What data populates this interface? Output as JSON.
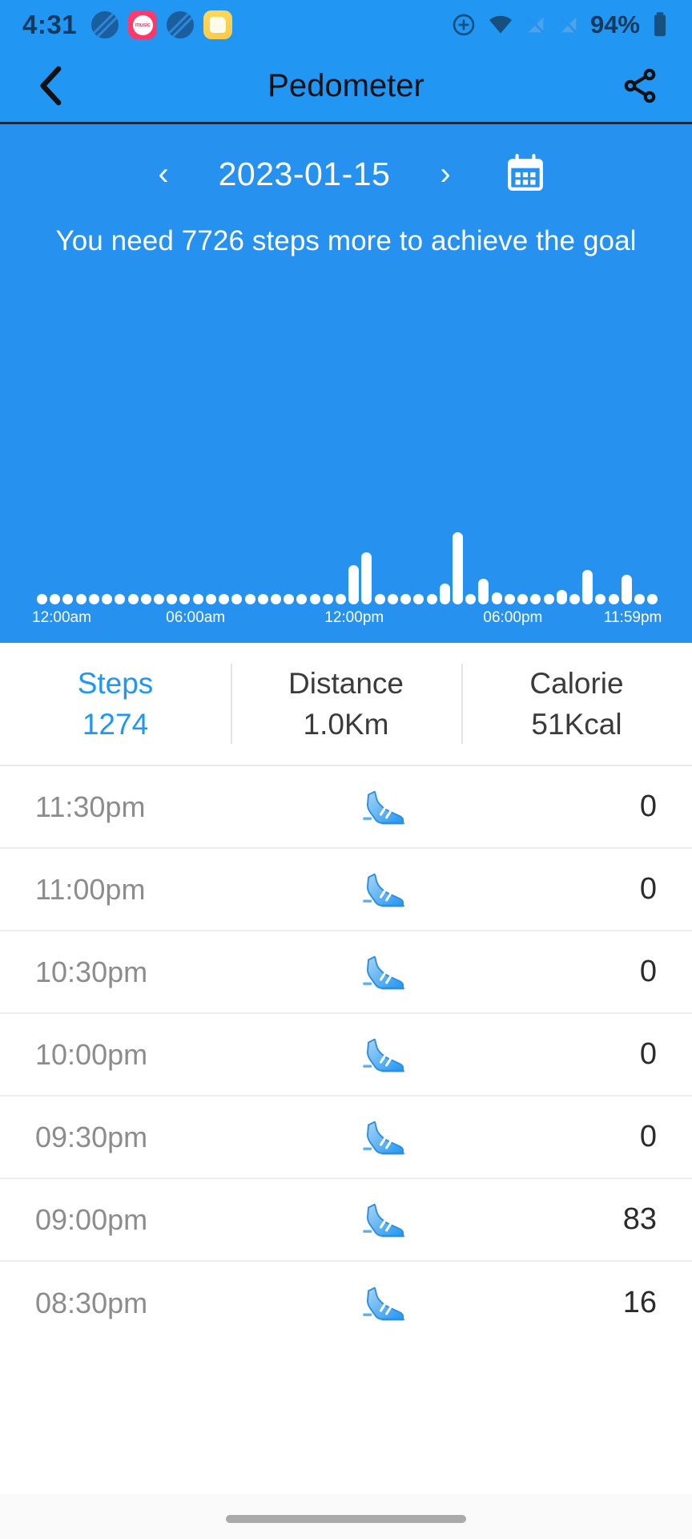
{
  "status_bar": {
    "time": "4:31",
    "battery_percent": "94%",
    "left_icons": [
      "disc-icon",
      "music-app-icon",
      "disc-icon",
      "folder-app-icon"
    ],
    "right_icons": [
      "alarm-add-icon",
      "wifi-icon",
      "signal-off-icon",
      "signal-off-icon",
      "battery-icon"
    ],
    "music_icon_label": "music"
  },
  "app_bar": {
    "back_icon": "back-chevron-icon",
    "title": "Pedometer",
    "share_icon": "share-icon"
  },
  "date_nav": {
    "prev_label": "‹",
    "date": "2023-01-15",
    "next_label": "›",
    "calendar_icon": "calendar-icon"
  },
  "goal_message": "You need 7726 steps more to achieve the goal",
  "colors": {
    "brand_blue": "#2196F3",
    "panel_blue": "#2691ef",
    "bar_white": "#ffffff",
    "accent": "#2196F3",
    "muted_text": "#8c8c8c"
  },
  "chart_data": {
    "type": "bar",
    "title": "",
    "xlabel": "",
    "ylabel": "Steps",
    "grid": false,
    "legend": null,
    "ylim": [
      0,
      700
    ],
    "x_tick_labels": [
      "12:00am",
      "06:00am",
      "12:00pm",
      "06:00pm",
      "11:59pm"
    ],
    "x_tick_positions": [
      0,
      12,
      24,
      36,
      47
    ],
    "categories": [
      "12:00am",
      "12:30am",
      "01:00am",
      "01:30am",
      "02:00am",
      "02:30am",
      "03:00am",
      "03:30am",
      "04:00am",
      "04:30am",
      "05:00am",
      "05:30am",
      "06:00am",
      "06:30am",
      "07:00am",
      "07:30am",
      "08:00am",
      "08:30am",
      "09:00am",
      "09:30am",
      "10:00am",
      "10:30am",
      "11:00am",
      "11:30am",
      "12:00pm",
      "12:30pm",
      "01:00pm",
      "01:30pm",
      "02:00pm",
      "02:30pm",
      "03:00pm",
      "03:30pm",
      "04:00pm",
      "04:30pm",
      "05:00pm",
      "05:30pm",
      "06:00pm",
      "06:30pm",
      "07:00pm",
      "07:30pm",
      "08:00pm",
      "08:30pm",
      "09:00pm",
      "09:30pm",
      "10:00pm",
      "10:30pm",
      "11:00pm",
      "11:30pm"
    ],
    "values": [
      0,
      0,
      0,
      0,
      0,
      0,
      0,
      0,
      0,
      0,
      0,
      0,
      0,
      0,
      0,
      0,
      0,
      0,
      0,
      0,
      0,
      0,
      0,
      8,
      96,
      126,
      0,
      0,
      0,
      0,
      18,
      50,
      176,
      0,
      62,
      30,
      0,
      0,
      0,
      0,
      36,
      0,
      83,
      16,
      8,
      72,
      0,
      0
    ]
  },
  "stats": [
    {
      "label": "Steps",
      "value": "1274",
      "accent": true
    },
    {
      "label": "Distance",
      "value": "1.0Km",
      "accent": false
    },
    {
      "label": "Calorie",
      "value": "51Kcal",
      "accent": false
    }
  ],
  "list_rows": [
    {
      "time": "11:30pm",
      "icon": "shoe-icon",
      "steps": "0"
    },
    {
      "time": "11:00pm",
      "icon": "shoe-icon",
      "steps": "0"
    },
    {
      "time": "10:30pm",
      "icon": "shoe-icon",
      "steps": "0"
    },
    {
      "time": "10:00pm",
      "icon": "shoe-icon",
      "steps": "0"
    },
    {
      "time": "09:30pm",
      "icon": "shoe-icon",
      "steps": "0"
    },
    {
      "time": "09:00pm",
      "icon": "shoe-icon",
      "steps": "83"
    },
    {
      "time": "08:30pm",
      "icon": "shoe-icon",
      "steps": "16"
    }
  ]
}
